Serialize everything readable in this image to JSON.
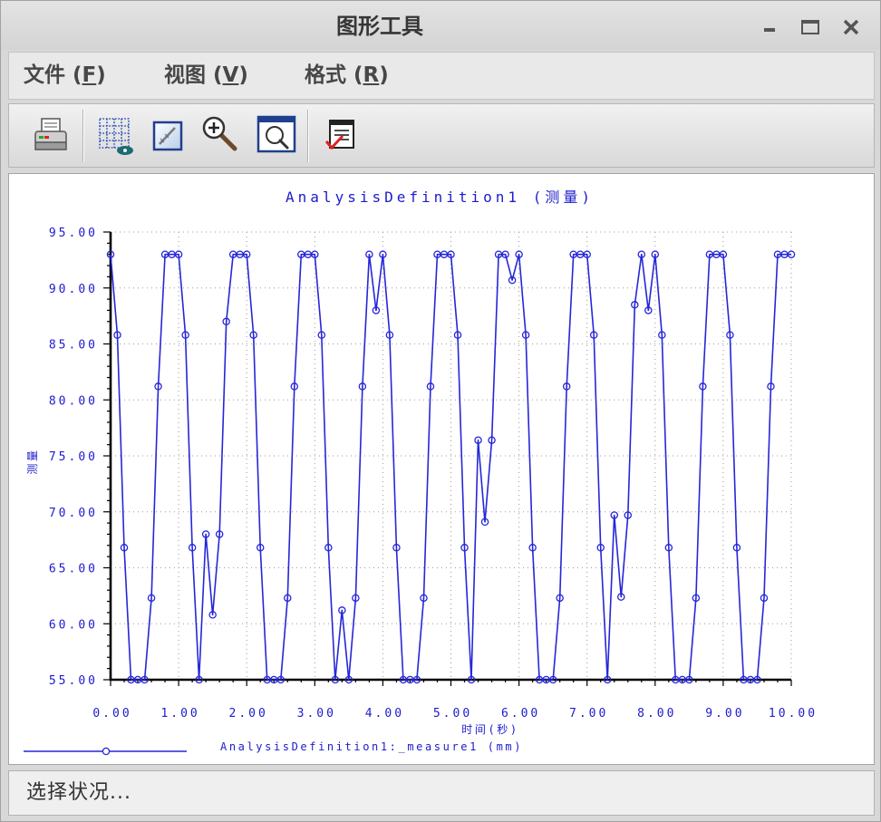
{
  "window": {
    "title": "图形工具",
    "controls": [
      {
        "name": "minimize",
        "icon": "minimize-icon"
      },
      {
        "name": "maximize",
        "icon": "maximize-icon"
      },
      {
        "name": "close",
        "icon": "close-icon"
      }
    ]
  },
  "menubar": {
    "items": [
      {
        "label": "文件 (F)",
        "hotkey": "F"
      },
      {
        "label": "视图 (V)",
        "hotkey": "V"
      },
      {
        "label": "格式 (R)",
        "hotkey": "R"
      }
    ]
  },
  "toolbar": {
    "buttons": [
      {
        "icon": "printer-icon"
      },
      {
        "icon": "format-grid-icon"
      },
      {
        "icon": "edit-graph-icon"
      },
      {
        "icon": "zoom-in-icon"
      },
      {
        "icon": "refit-icon"
      },
      {
        "icon": "export-report-icon"
      }
    ]
  },
  "colors": {
    "series": "#2626d9",
    "chart_text": "#1c1ccc",
    "axis": "#000000",
    "grid": "#9a9a9a",
    "panel_background": "#ffffff"
  },
  "chart_data": {
    "type": "line",
    "title": "AnalysisDefinition1 (测量)",
    "xlabel": "时间(秒)",
    "ylabel": "测量",
    "xlim": [
      0,
      10
    ],
    "ylim": [
      55,
      95
    ],
    "xticks": [
      0,
      1,
      2,
      3,
      4,
      5,
      6,
      7,
      8,
      9,
      10
    ],
    "xtick_labels": [
      "0.00",
      "1.00",
      "2.00",
      "3.00",
      "4.00",
      "5.00",
      "6.00",
      "7.00",
      "8.00",
      "9.00",
      "10.00"
    ],
    "yticks": [
      55,
      60,
      65,
      70,
      75,
      80,
      85,
      90,
      95
    ],
    "ytick_labels": [
      "55.00",
      "60.00",
      "65.00",
      "70.00",
      "75.00",
      "80.00",
      "85.00",
      "90.00",
      "95.00"
    ],
    "grid": true,
    "legend": "bottom-left",
    "marker": "circle",
    "series": [
      {
        "name": "AnalysisDefinition1:_measure1 (mm)",
        "x": [
          0.0,
          0.1,
          0.2,
          0.3,
          0.4,
          0.5,
          0.6,
          0.7,
          0.8,
          0.9,
          1.0,
          1.1,
          1.2,
          1.3,
          1.4,
          1.5,
          1.6,
          1.7,
          1.8,
          1.9,
          2.0,
          2.1,
          2.2,
          2.3,
          2.4,
          2.5,
          2.6,
          2.7,
          2.8,
          2.9,
          3.0,
          3.1,
          3.2,
          3.3,
          3.4,
          3.5,
          3.6,
          3.7,
          3.8,
          3.9,
          4.0,
          4.1,
          4.2,
          4.3,
          4.4,
          4.5,
          4.6,
          4.7,
          4.8,
          4.9,
          5.0,
          5.1,
          5.2,
          5.3,
          5.4,
          5.5,
          5.6,
          5.7,
          5.8,
          5.9,
          6.0,
          6.1,
          6.2,
          6.3,
          6.4,
          6.5,
          6.6,
          6.7,
          6.8,
          6.9,
          7.0,
          7.1,
          7.2,
          7.3,
          7.4,
          7.5,
          7.6,
          7.7,
          7.8,
          7.9,
          8.0,
          8.1,
          8.2,
          8.3,
          8.4,
          8.5,
          8.6,
          8.7,
          8.8,
          8.9,
          9.0,
          9.1,
          9.2,
          9.3,
          9.4,
          9.5,
          9.6,
          9.7,
          9.8,
          9.9,
          10.0
        ],
        "y": [
          93.0,
          85.8,
          66.8,
          55.0,
          55.0,
          55.0,
          62.3,
          81.2,
          93.0,
          93.0,
          93.0,
          85.8,
          66.8,
          55.0,
          68.0,
          60.8,
          68.0,
          87.0,
          93.0,
          93.0,
          93.0,
          85.8,
          66.8,
          55.0,
          55.0,
          55.0,
          62.3,
          81.2,
          93.0,
          93.0,
          93.0,
          85.8,
          66.8,
          55.0,
          61.2,
          55.0,
          62.3,
          81.2,
          93.0,
          88.0,
          93.0,
          85.8,
          66.8,
          55.0,
          55.0,
          55.0,
          62.3,
          81.2,
          93.0,
          93.0,
          93.0,
          85.8,
          66.8,
          55.0,
          76.4,
          69.1,
          76.4,
          93.0,
          93.0,
          90.7,
          93.0,
          85.8,
          66.8,
          55.0,
          55.0,
          55.0,
          62.3,
          81.2,
          93.0,
          93.0,
          93.0,
          85.8,
          66.8,
          55.0,
          69.7,
          62.4,
          69.7,
          88.5,
          93.0,
          88.0,
          93.0,
          85.8,
          66.8,
          55.0,
          55.0,
          55.0,
          62.3,
          81.2,
          93.0,
          93.0,
          93.0,
          85.8,
          66.8,
          55.0,
          55.0,
          55.0,
          62.3,
          81.2,
          93.0,
          93.0,
          93.0
        ]
      }
    ]
  },
  "status": {
    "text": "选择状况..."
  }
}
